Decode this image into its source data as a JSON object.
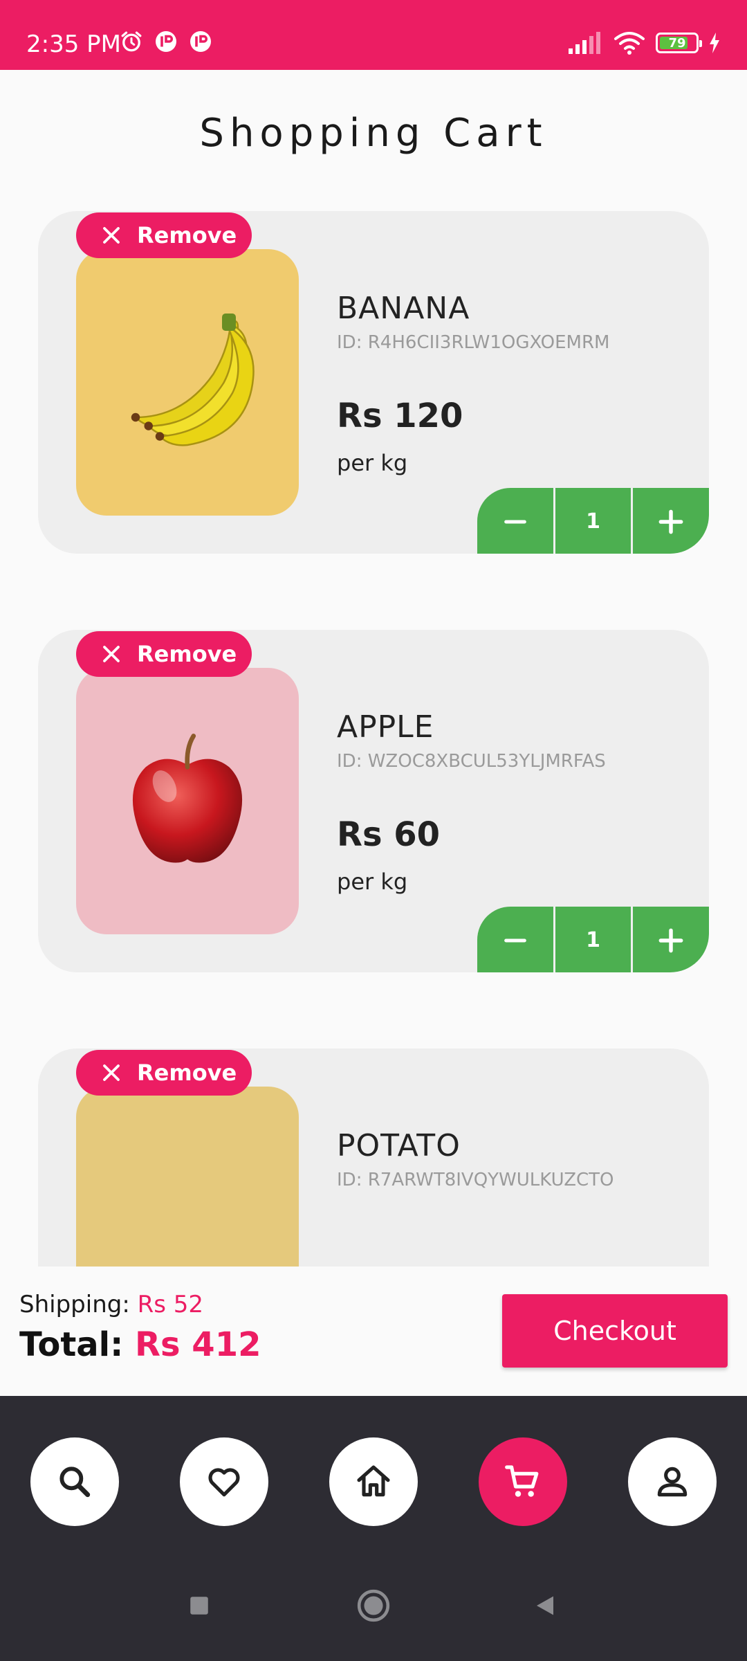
{
  "status_bar": {
    "time": "2:35 PM",
    "battery_percent": 79
  },
  "title": "Shopping Cart",
  "colors": {
    "accent": "#EC1D63",
    "stepper": "#4CAF50",
    "nav_bg": "#2D2C33"
  },
  "items": [
    {
      "name": "BANANA",
      "id": "ID: R4H6CII3RLW1OGXOEMRM",
      "price": "Rs 120",
      "unit": "per kg",
      "quantity": "1",
      "remove_label": "Remove",
      "image_icon": "banana-image",
      "bg": "#F0CB6E"
    },
    {
      "name": "APPLE",
      "id": "ID: WZOC8XBCUL53YLJMRFAS",
      "price": "Rs 60",
      "unit": "per kg",
      "quantity": "1",
      "remove_label": "Remove",
      "image_icon": "apple-image",
      "bg": "#EFBCC4"
    },
    {
      "name": "POTATO",
      "id": "ID: R7ARWT8IVQYWULKUZCTO",
      "price": "",
      "unit": "",
      "quantity": "",
      "remove_label": "Remove",
      "image_icon": "potato-image",
      "bg": "#E5C97C"
    }
  ],
  "summary": {
    "shipping_label": "Shipping:",
    "shipping_value": "Rs 52",
    "total_label": "Total:",
    "total_value": "Rs 412",
    "checkout_label": "Checkout"
  },
  "nav": {
    "items": [
      "search-icon",
      "heart-icon",
      "home-icon",
      "cart-icon",
      "profile-icon"
    ],
    "active": "cart-icon"
  }
}
